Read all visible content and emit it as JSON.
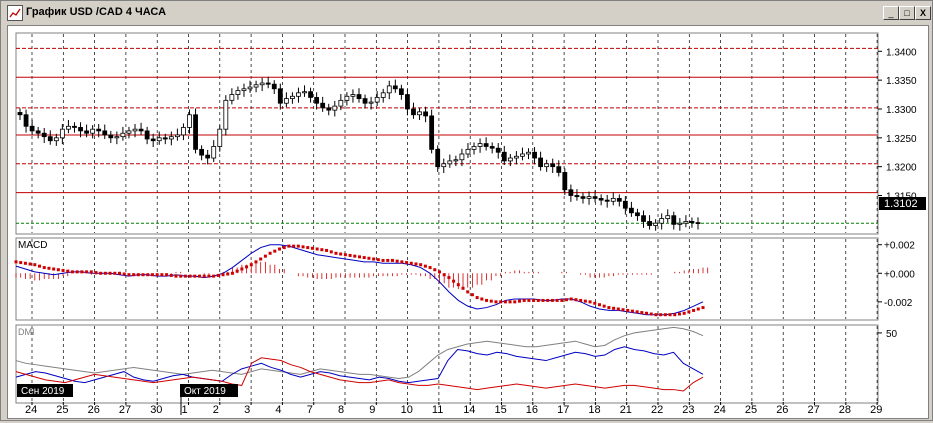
{
  "window": {
    "title": "График USD /CAD  4 ЧАСА",
    "buttons": {
      "minimize": "_",
      "maximize": "□",
      "close": "X"
    }
  },
  "price_panel": {
    "last_price": "1.3102",
    "colors": {
      "level_line": "#c00000",
      "current_line": "#008000",
      "candle": "#000000"
    },
    "chart_data": {
      "type": "candlestick",
      "y_ticks": [
        "1.3400",
        "1.3350",
        "1.3300",
        "1.3250",
        "1.3200",
        "1.3150"
      ],
      "ylim": [
        1.3085,
        1.343
      ],
      "levels": [
        1.3405,
        1.3355,
        1.3302,
        1.3255,
        1.3205,
        1.3155,
        1.3102
      ],
      "x_labels": [
        "24",
        "25",
        "26",
        "27",
        "30",
        "1",
        "2",
        "3",
        "4",
        "7",
        "8",
        "9",
        "10",
        "11",
        "14",
        "15",
        "16",
        "17",
        "18",
        "21",
        "22",
        "23",
        "24",
        "25",
        "26",
        "27",
        "28",
        "29"
      ],
      "closes": [
        1.329,
        1.327,
        1.3262,
        1.3258,
        1.3252,
        1.3245,
        1.325,
        1.3265,
        1.327,
        1.3268,
        1.3262,
        1.3258,
        1.3265,
        1.3262,
        1.3255,
        1.325,
        1.3252,
        1.3258,
        1.3262,
        1.3265,
        1.3262,
        1.3248,
        1.3245,
        1.325,
        1.3248,
        1.3252,
        1.3255,
        1.3268,
        1.329,
        1.323,
        1.322,
        1.3215,
        1.3235,
        1.3265,
        1.3315,
        1.3325,
        1.3332,
        1.3335,
        1.3338,
        1.3342,
        1.3345,
        1.3343,
        1.3335,
        1.331,
        1.3318,
        1.3322,
        1.3328,
        1.333,
        1.332,
        1.331,
        1.3302,
        1.3298,
        1.3305,
        1.3315,
        1.3322,
        1.3325,
        1.3318,
        1.331,
        1.3312,
        1.332,
        1.3328,
        1.334,
        1.3335,
        1.3325,
        1.33,
        1.329,
        1.3295,
        1.3288,
        1.323,
        1.32,
        1.3205,
        1.321,
        1.3212,
        1.3222,
        1.323,
        1.3235,
        1.324,
        1.3235,
        1.3232,
        1.3225,
        1.321,
        1.3215,
        1.3218,
        1.3222,
        1.3225,
        1.3215,
        1.32,
        1.3205,
        1.32,
        1.319,
        1.316,
        1.315,
        1.3148,
        1.3145,
        1.3148,
        1.3145,
        1.3142,
        1.314,
        1.3145,
        1.314,
        1.3128,
        1.312,
        1.3115,
        1.3105,
        1.3098,
        1.3102,
        1.311,
        1.3115,
        1.31,
        1.3102,
        1.3105,
        1.3103,
        1.3102
      ]
    }
  },
  "macd_panel": {
    "label": "MACD",
    "y_ticks": [
      "+0.002",
      "+0.000",
      "-0.002"
    ],
    "colors": {
      "signal": "#d00000",
      "macd": "#0000c0",
      "hist": "#d00000"
    },
    "chart_data": {
      "type": "line",
      "ylim": [
        -0.0032,
        0.0024
      ],
      "macd": [
        0.0005,
        0.0003,
        0.0001,
        0.0,
        -0.0001,
        0.0,
        0.0001,
        0.0001,
        0.0,
        0.0,
        0.0,
        -0.0001,
        -0.0002,
        -0.0001,
        -0.0001,
        -0.0002,
        -0.0002,
        -0.0001,
        -0.0002,
        -0.0002,
        -0.0003,
        -0.0002,
        0.0,
        0.0004,
        0.0009,
        0.0014,
        0.0018,
        0.002,
        0.002,
        0.0019,
        0.0017,
        0.0015,
        0.0013,
        0.0012,
        0.0011,
        0.001,
        0.0009,
        0.0008,
        0.0008,
        0.0007,
        0.0007,
        0.0007,
        0.0006,
        0.0004,
        0.0,
        -0.0006,
        -0.0013,
        -0.0019,
        -0.0023,
        -0.0025,
        -0.0024,
        -0.0022,
        -0.0019,
        -0.0018,
        -0.0018,
        -0.0018,
        -0.0019,
        -0.0019,
        -0.0018,
        -0.0018,
        -0.002,
        -0.0023,
        -0.0025,
        -0.0026,
        -0.0026,
        -0.0027,
        -0.0028,
        -0.0029,
        -0.0029,
        -0.0029,
        -0.0028,
        -0.0026,
        -0.0023,
        -0.002
      ],
      "signal": [
        0.0008,
        0.0007,
        0.0006,
        0.0004,
        0.0003,
        0.0002,
        0.0001,
        0.0001,
        0.0001,
        0.0,
        0.0,
        0.0,
        -0.0001,
        -0.0001,
        -0.0001,
        -0.0001,
        -0.0001,
        -0.0002,
        -0.0002,
        -0.0002,
        -0.0002,
        -0.0002,
        -0.0001,
        0.0,
        0.0003,
        0.0006,
        0.001,
        0.0014,
        0.0017,
        0.0019,
        0.0019,
        0.0018,
        0.0017,
        0.0016,
        0.0014,
        0.0013,
        0.0012,
        0.0011,
        0.001,
        0.0009,
        0.0009,
        0.0008,
        0.0007,
        0.0006,
        0.0004,
        0.0001,
        -0.0003,
        -0.0008,
        -0.0013,
        -0.0017,
        -0.0019,
        -0.002,
        -0.002,
        -0.002,
        -0.0019,
        -0.0019,
        -0.0019,
        -0.0019,
        -0.0019,
        -0.0018,
        -0.0019,
        -0.002,
        -0.0022,
        -0.0024,
        -0.0025,
        -0.0026,
        -0.0027,
        -0.0028,
        -0.0029,
        -0.0029,
        -0.0029,
        -0.0028,
        -0.0026,
        -0.0024
      ]
    }
  },
  "dmi_panel": {
    "label": "DMI",
    "y_ticks": [
      "50"
    ],
    "colors": {
      "plus_di": "#0000c0",
      "minus_di": "#d00000",
      "adx": "#808080"
    },
    "chart_data": {
      "type": "line",
      "ylim": [
        0,
        55
      ],
      "plus_di": [
        18,
        20,
        22,
        21,
        19,
        17,
        15,
        14,
        16,
        18,
        20,
        22,
        18,
        16,
        15,
        17,
        19,
        20,
        18,
        17,
        16,
        15,
        20,
        24,
        26,
        28,
        25,
        23,
        20,
        18,
        20,
        22,
        21,
        19,
        18,
        17,
        16,
        18,
        17,
        15,
        14,
        15,
        16,
        17,
        30,
        38,
        37,
        35,
        34,
        36,
        35,
        33,
        32,
        31,
        30,
        32,
        34,
        36,
        35,
        33,
        34,
        38,
        40,
        38,
        37,
        35,
        34,
        36,
        28,
        24,
        20
      ],
      "minus_di": [
        22,
        20,
        18,
        16,
        15,
        14,
        16,
        18,
        20,
        19,
        18,
        17,
        16,
        15,
        14,
        15,
        16,
        17,
        18,
        17,
        16,
        15,
        13,
        12,
        28,
        32,
        31,
        30,
        27,
        25,
        22,
        20,
        18,
        16,
        15,
        14,
        14,
        15,
        16,
        14,
        13,
        12,
        12,
        13,
        12,
        11,
        10,
        9,
        10,
        11,
        12,
        13,
        12,
        11,
        10,
        11,
        12,
        13,
        12,
        11,
        10,
        11,
        12,
        12,
        11,
        10,
        9,
        9,
        8,
        14,
        18
      ],
      "adx": [
        30,
        28,
        27,
        26,
        25,
        24,
        23,
        22,
        21,
        22,
        23,
        24,
        25,
        24,
        23,
        22,
        21,
        20,
        21,
        22,
        23,
        22,
        21,
        20,
        22,
        24,
        23,
        22,
        21,
        20,
        22,
        24,
        23,
        22,
        21,
        20,
        20,
        19,
        18,
        17,
        18,
        22,
        28,
        34,
        38,
        40,
        42,
        43,
        44,
        43,
        42,
        41,
        40,
        40,
        41,
        42,
        43,
        44,
        42,
        40,
        41,
        45,
        48,
        50,
        51,
        52,
        53,
        54,
        53,
        51,
        48
      ]
    }
  },
  "date_axis": {
    "month_labels": [
      "Сен 2019",
      "Окт 2019"
    ],
    "x_labels": [
      "24",
      "25",
      "26",
      "27",
      "30",
      "1",
      "2",
      "3",
      "4",
      "7",
      "8",
      "9",
      "10",
      "11",
      "14",
      "15",
      "16",
      "17",
      "18",
      "21",
      "22",
      "23",
      "24",
      "25",
      "26",
      "27",
      "28",
      "29"
    ]
  }
}
